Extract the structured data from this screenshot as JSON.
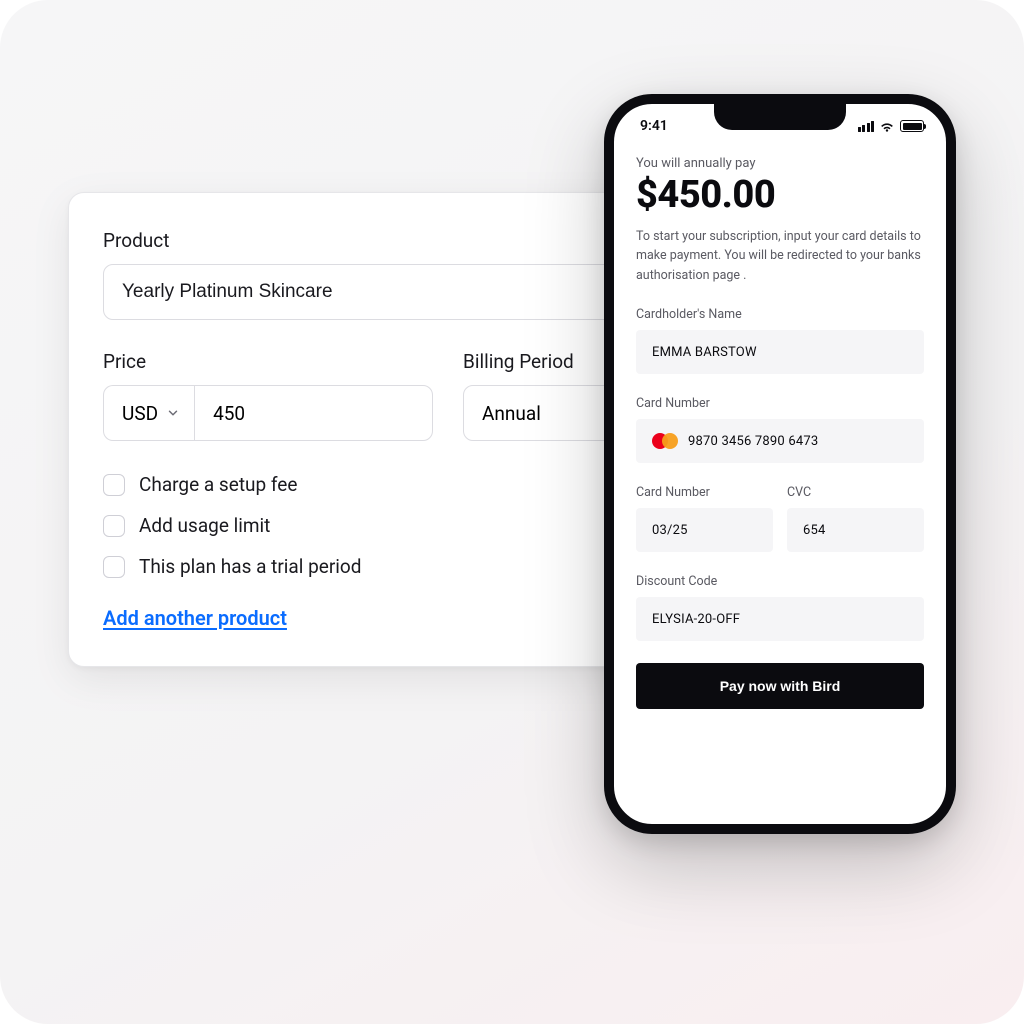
{
  "card": {
    "product_label": "Product",
    "product_value": "Yearly Platinum Skincare",
    "price_label": "Price",
    "currency": "USD",
    "price_value": "450",
    "billing_label": "Billing Period",
    "billing_value": "Annual",
    "options": {
      "setup_fee": "Charge a setup fee",
      "usage_limit": "Add usage limit",
      "trial_period": "This plan has a trial period"
    },
    "add_link": "Add another product"
  },
  "phone": {
    "time": "9:41",
    "caption": "You will annually pay",
    "amount": "$450.00",
    "description": "To start your subscription, input your card details to make payment. You will be redirected to your banks authorisation page .",
    "cardholder_label": "Cardholder's Name",
    "cardholder_value": "EMMA BARSTOW",
    "cardnumber_label": "Card Number",
    "cardnumber_value": "9870 3456 7890 6473",
    "expiry_label": "Card Number",
    "expiry_value": "03/25",
    "cvc_label": "CVC",
    "cvc_value": "654",
    "discount_label": "Discount Code",
    "discount_value": "ELYSIA-20-OFF",
    "pay_button": "Pay now with Bird"
  }
}
